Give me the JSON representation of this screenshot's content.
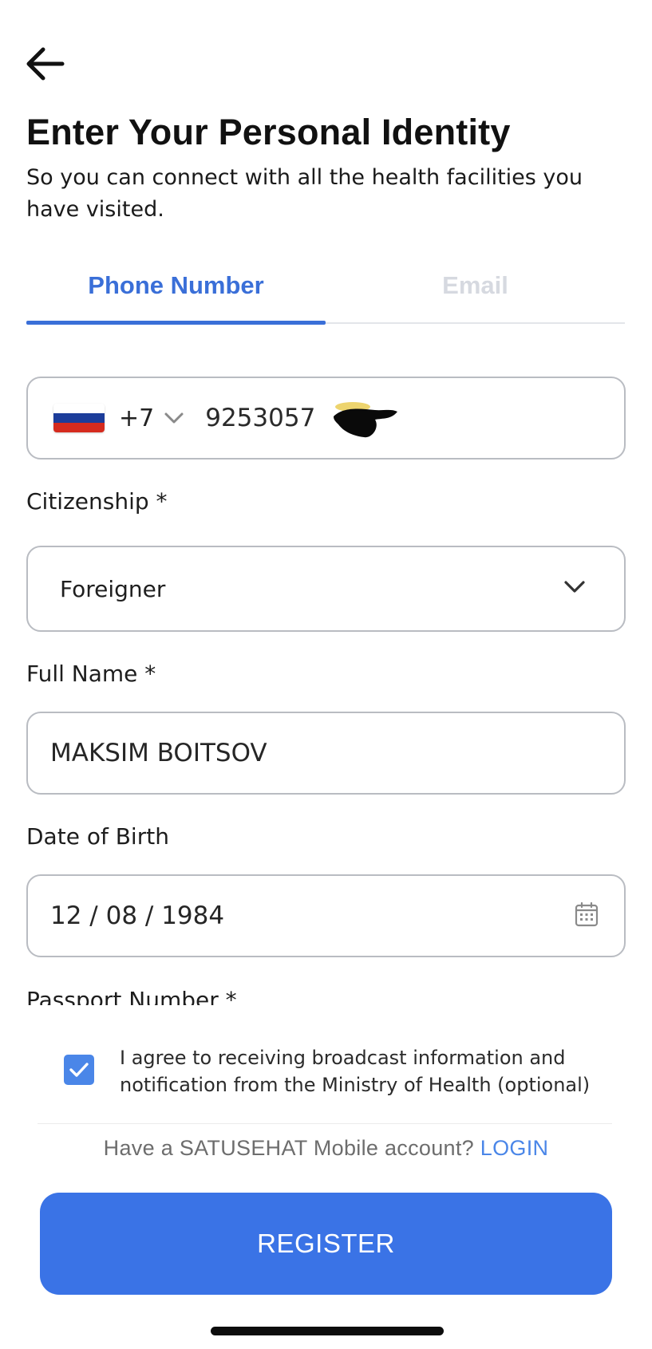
{
  "header": {
    "title": "Enter Your Personal Identity",
    "subtitle": "So you can connect with all the health facilities you have visited."
  },
  "tabs": [
    {
      "label": "Phone Number",
      "active": true
    },
    {
      "label": "Email",
      "active": false
    }
  ],
  "phone": {
    "country_code": "+7",
    "number": "9253057",
    "flag_colors": [
      "#ffffff",
      "#1c3d9a",
      "#d52b1e"
    ]
  },
  "citizenship": {
    "label": "Citizenship *",
    "value": "Foreigner"
  },
  "full_name": {
    "label": "Full Name *",
    "value": "MAKSIM BOITSOV"
  },
  "dob": {
    "label": "Date of Birth",
    "value": "12 / 08 / 1984"
  },
  "passport": {
    "label": "Passport Number *"
  },
  "consent": {
    "checked": true,
    "text": "I agree to receiving broadcast information and notification from the Ministry of Health (optional)"
  },
  "login": {
    "prompt": "Have a SATUSEHAT Mobile account?",
    "link": "LOGIN"
  },
  "register_label": "REGISTER",
  "colors": {
    "accent": "#3a73e6",
    "tab_active": "#3a6fd8",
    "tab_inactive": "#d6d9e0",
    "checkbox": "#4a86e8"
  }
}
